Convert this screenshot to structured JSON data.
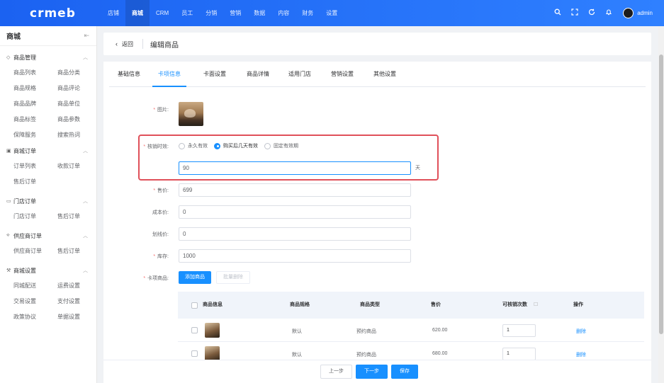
{
  "brand": {
    "logo_text": "crmeb"
  },
  "topnav": {
    "items": [
      {
        "label": "店铺"
      },
      {
        "label": "商城"
      },
      {
        "label": "CRM"
      },
      {
        "label": "员工"
      },
      {
        "label": "分销"
      },
      {
        "label": "营销"
      },
      {
        "label": "数据"
      },
      {
        "label": "内容"
      },
      {
        "label": "财务"
      },
      {
        "label": "设置"
      }
    ],
    "active": "商城",
    "icons": [
      "search-icon",
      "fullscreen-icon",
      "refresh-icon",
      "bell-icon"
    ],
    "username": "admin"
  },
  "sidebar": {
    "title": "商城",
    "groups": [
      {
        "label": "商品管理",
        "items": [
          "商品列表",
          "商品分类",
          "商品规格",
          "商品评论",
          "商品品牌",
          "商品单位",
          "商品标签",
          "商品参数",
          "保障服务",
          "搜索热词"
        ]
      },
      {
        "label": "商城订单",
        "items": [
          "订单列表",
          "收款订单",
          "售后订单"
        ]
      },
      {
        "label": "门店订单",
        "items": [
          "门店订单",
          "售后订单"
        ]
      },
      {
        "label": "供应商订单",
        "items": [
          "供应商订单",
          "售后订单"
        ]
      },
      {
        "label": "商城设置",
        "items": [
          "同城配送",
          "运费设置",
          "交易设置",
          "支付设置",
          "政策协议",
          "单据设置"
        ]
      }
    ]
  },
  "header": {
    "back_label": "返回",
    "title": "编辑商品"
  },
  "tabs": [
    {
      "label": "基础信息"
    },
    {
      "label": "卡项信息"
    },
    {
      "label": "卡面设置"
    },
    {
      "label": "商品详情"
    },
    {
      "label": "适用门店"
    },
    {
      "label": "营销设置"
    },
    {
      "label": "其他设置"
    }
  ],
  "active_tab": "卡项信息",
  "form": {
    "image_label": "图片:",
    "validity_label": "核销时效:",
    "validity_options": [
      "永久有效",
      "购买后几天有效",
      "固定有效期"
    ],
    "validity_selected": "购买后几天有效",
    "days_value": "90",
    "days_unit": "天",
    "price_label": "售价:",
    "price_value": "699",
    "cost_label": "成本价:",
    "cost_value": "0",
    "original_label": "划线价:",
    "original_value": "0",
    "stock_label": "库存:",
    "stock_value": "1000",
    "items_label": "卡项商品:",
    "add_button": "添加商品",
    "batch_delete_button": "批量删除"
  },
  "table": {
    "columns": [
      "商品信息",
      "商品规格",
      "商品类型",
      "售价",
      "可核销次数",
      "操作"
    ],
    "rows": [
      {
        "spec": "默认",
        "type": "预约商品",
        "price": "620.00",
        "times": "1",
        "action": "删除"
      },
      {
        "spec": "默认",
        "type": "预约商品",
        "price": "680.00",
        "times": "1",
        "action": "删除"
      }
    ]
  },
  "footer": {
    "prev": "上一步",
    "next": "下一步",
    "save": "保存"
  },
  "colors": {
    "primary": "#1890ff",
    "topbar": "#2a78fb",
    "highlight_border": "#e0505a",
    "required": "#f56c6c"
  }
}
